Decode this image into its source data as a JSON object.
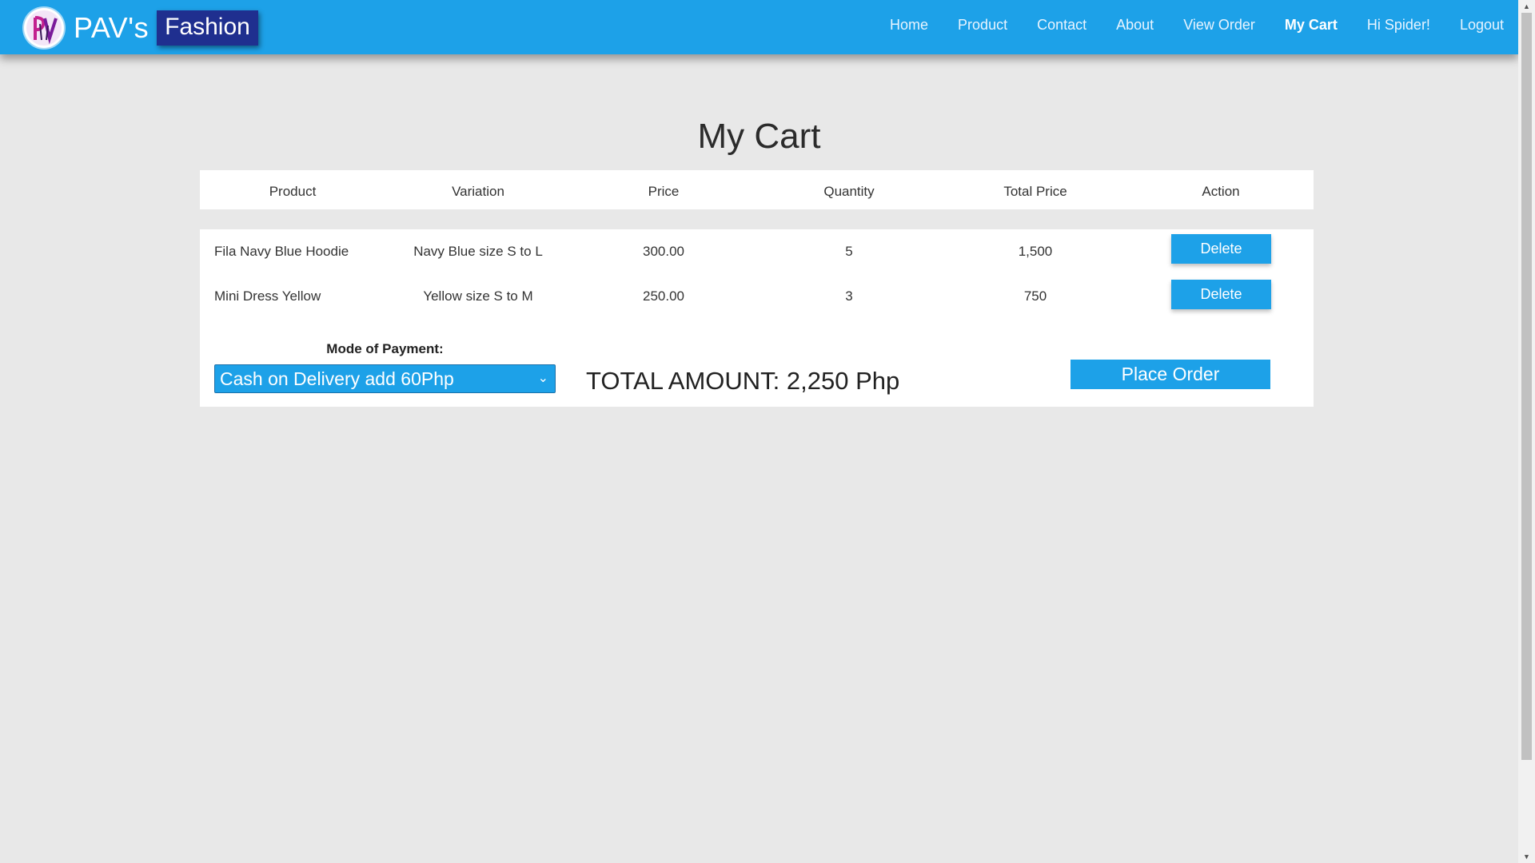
{
  "brand": {
    "name": "PAV's",
    "tag": "Fashion",
    "logo_text": "PV"
  },
  "nav": {
    "items": [
      "Home",
      "Product",
      "Contact",
      "About",
      "View Order",
      "My Cart",
      "Hi Spider!",
      "Logout"
    ],
    "active": "My Cart"
  },
  "page_title": "My Cart",
  "table": {
    "headers": [
      "Product",
      "Variation",
      "Price",
      "Quantity",
      "Total Price",
      "Action"
    ],
    "rows": [
      {
        "product": "Fila Navy Blue Hoodie",
        "variation": "Navy Blue size S to L",
        "price": "300.00",
        "quantity": "5",
        "total": "1,500",
        "action": "Delete"
      },
      {
        "product": "Mini Dress Yellow",
        "variation": "Yellow size S to M",
        "price": "250.00",
        "quantity": "3",
        "total": "750",
        "action": "Delete"
      }
    ]
  },
  "payment": {
    "label": "Mode of Payment:",
    "selected": "Cash on Delivery add 60Php"
  },
  "total_amount": "TOTAL AMOUNT: 2,250 Php",
  "place_order_label": "Place Order",
  "colors": {
    "accent": "#1da1e8",
    "brand_tag_bg": "#1f2f8f",
    "page_bg": "#e8e8e8",
    "panel_bg": "#ffffff"
  }
}
